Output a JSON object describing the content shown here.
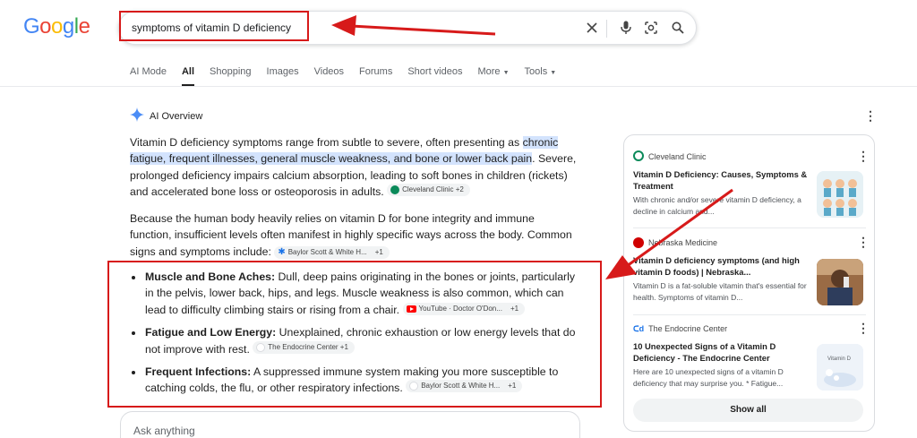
{
  "header": {
    "logo_letters": [
      {
        "ch": "G",
        "color": "#4285f4"
      },
      {
        "ch": "o",
        "color": "#ea4335"
      },
      {
        "ch": "o",
        "color": "#fbbc05"
      },
      {
        "ch": "g",
        "color": "#4285f4"
      },
      {
        "ch": "l",
        "color": "#34a853"
      },
      {
        "ch": "e",
        "color": "#ea4335"
      }
    ],
    "query": "symptoms of vitamin D deficiency",
    "icons": [
      "clear-icon",
      "mic-icon",
      "lens-icon",
      "search-icon"
    ]
  },
  "tabs": {
    "ai_mode": "AI Mode",
    "all": "All",
    "shopping": "Shopping",
    "images": "Images",
    "videos": "Videos",
    "forums": "Forums",
    "short_videos": "Short videos",
    "more": "More",
    "tools": "Tools"
  },
  "ai_overview": {
    "title": "AI Overview",
    "p1_before": "Vitamin D deficiency symptoms range from subtle to severe, often presenting as ",
    "p1_highlight": "chronic fatigue, frequent illnesses, general muscle weakness, and bone or lower back pain",
    "p1_after": ". Severe, prolonged deficiency impairs calcium absorption, leading to soft bones in children (rickets) and accelerated bone loss or osteoporosis in adults.",
    "p1_chip": "Cleveland Clinic +2",
    "p2": "Because the human body heavily relies on vitamin D for bone integrity and immune function, insufficient levels often manifest in highly specific ways across the body. Common signs and symptoms include:",
    "p2_chip_name": "Baylor Scott & White H...",
    "p2_chip_count": "+1",
    "bullets": [
      {
        "term": "Muscle and Bone Aches:",
        "text": " Dull, deep pains originating in the bones or joints, particularly in the pelvis, lower back, hips, and legs. Muscle weakness is also common, which can lead to difficulty climbing stairs or rising from a chair.",
        "chip_name": "YouTube · Doctor O'Don...",
        "chip_count": "+1"
      },
      {
        "term": "Fatigue and Low Energy:",
        "text": " Unexplained, chronic exhaustion or low energy levels that do not improve with rest.",
        "chip_name": "The Endocrine Center +1",
        "chip_count": ""
      },
      {
        "term": "Frequent Infections:",
        "text": " A suppressed immune system making you more susceptible to catching colds, the flu, or other respiratory infections.",
        "chip_name": "Baylor Scott & White H...",
        "chip_count": "+1"
      }
    ],
    "ask_placeholder": "Ask anything"
  },
  "sources": {
    "cards": [
      {
        "site": "Cleveland Clinic",
        "title": "Vitamin D Deficiency: Causes, Symptoms & Treatment",
        "snippet": "With chronic and/or severe vitamin D deficiency, a decline in calcium and...",
        "logo_color": "#0b8a5a"
      },
      {
        "site": "Nebraska Medicine",
        "title": "Vitamin D deficiency symptoms (and high vitamin D foods) | Nebraska...",
        "snippet": "Vitamin D is a fat-soluble vitamin that's essential for health. Symptoms of vitamin D...",
        "logo_color": "#d00000"
      },
      {
        "site": "The Endocrine Center",
        "title": "10 Unexpected Signs of a Vitamin D Deficiency - The Endocrine Center",
        "snippet": "Here are 10 unexpected signs of a vitamin D deficiency that may surprise you. * Fatigue...",
        "logo_color": "#1a73e8"
      }
    ],
    "thumb3_text": "Vitamin D",
    "show_all": "Show all"
  },
  "colors": {
    "annotation_red": "#d71a1a",
    "highlight_blue": "#d3e3fd",
    "gemini_blue": "#4c8df6"
  }
}
